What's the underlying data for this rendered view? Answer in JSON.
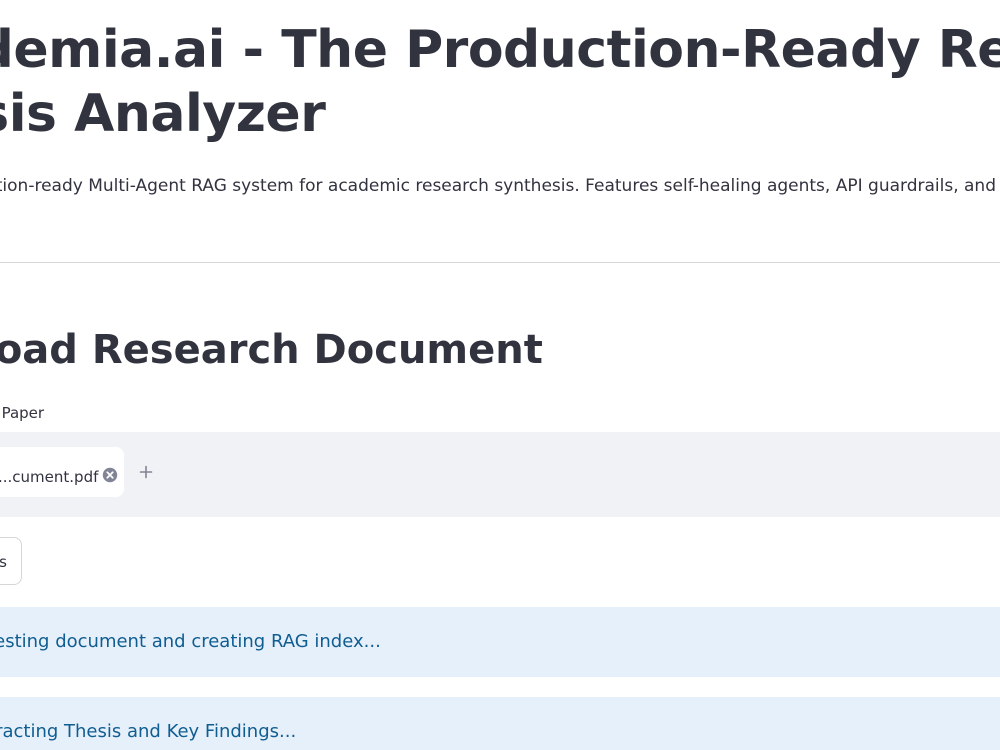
{
  "header": {
    "title_line1": "Academia.ai - The Production-Ready Research",
    "title_line2": "Thesis Analyzer",
    "subtitle": "A production-ready Multi-Agent RAG system for academic research synthesis. Features self-healing agents, API guardrails, and comprehensive"
  },
  "upload_section": {
    "heading": "Upload Research Document",
    "uploader_label": "Research Paper",
    "file_chip": {
      "file_name": "document.pdf",
      "visible_file_name": "...cument.pdf",
      "remove_icon": "close-circle-icon"
    },
    "add_icon": "plus-icon",
    "action_button_label": "s"
  },
  "status": {
    "alerts": [
      {
        "text": "Ingesting document and creating RAG index..."
      },
      {
        "text": "Extracting Thesis and Key Findings..."
      }
    ]
  },
  "colors": {
    "text": "#31333f",
    "dropzone_bg": "#f0f2f6",
    "alert_bg": "#e6f0fb",
    "alert_text": "#0f5d91",
    "divider": "#d6d6d9",
    "icon_muted": "#808495"
  }
}
